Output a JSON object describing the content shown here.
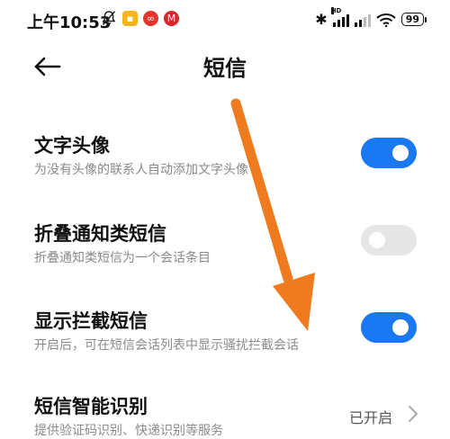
{
  "statusbar": {
    "time": "上午10:53",
    "left_icons": [
      "bell-off-icon",
      "app-notification-yellow-icon",
      "app-notification-red-icon",
      "app-notification-bank-icon"
    ],
    "signal_tag": "HD",
    "battery": "99"
  },
  "header": {
    "title": "短信",
    "back_icon": "back-arrow-icon"
  },
  "settings": [
    {
      "title": "文字头像",
      "subtitle": "为没有头像的联系人自动添加文字头像",
      "toggle": "on"
    },
    {
      "title": "折叠通知类短信",
      "subtitle": "折叠通知类短信为一个会话条目",
      "toggle": "off"
    },
    {
      "title": "显示拦截短信",
      "subtitle": "开启后，可在短信会话列表中显示骚扰拦截会话",
      "toggle": "on"
    },
    {
      "title": "短信智能识别",
      "subtitle": "提供验证码识别、快递识别等服务",
      "value": "已开启"
    }
  ],
  "colors": {
    "accent": "#1a78f2",
    "annotation_arrow": "#f07a1e"
  }
}
